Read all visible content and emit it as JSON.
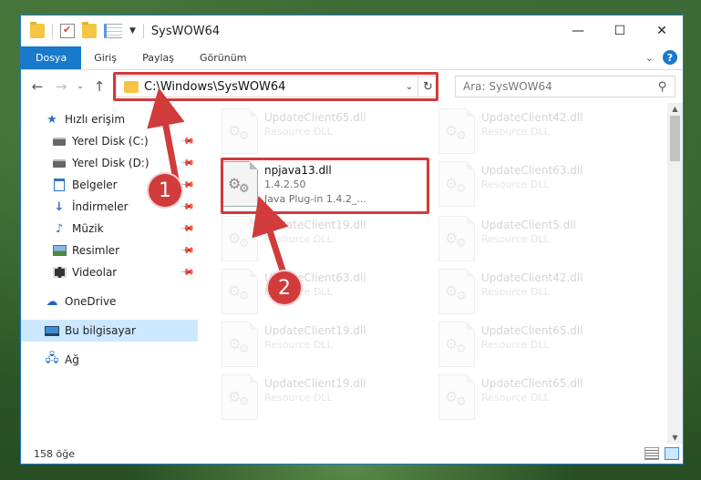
{
  "window": {
    "title": "SysWOW64",
    "controls": {
      "minimize": "—",
      "maximize": "☐",
      "close": "✕"
    }
  },
  "ribbon": {
    "tabs": [
      "Dosya",
      "Giriş",
      "Paylaş",
      "Görünüm"
    ],
    "help": "?"
  },
  "navigation": {
    "address_path": "C:\\Windows\\SysWOW64",
    "search_placeholder": "Ara: SysWOW64"
  },
  "sidebar": {
    "quick_access": "Hızlı erişim",
    "items": [
      {
        "label": "Yerel Disk (C:)",
        "icon": "drive-icon",
        "pinned": true
      },
      {
        "label": "Yerel Disk (D:)",
        "icon": "drive-icon",
        "pinned": true
      },
      {
        "label": "Belgeler",
        "icon": "documents-icon",
        "pinned": true
      },
      {
        "label": "İndirmeler",
        "icon": "downloads-icon",
        "pinned": true
      },
      {
        "label": "Müzik",
        "icon": "music-icon",
        "pinned": true
      },
      {
        "label": "Resimler",
        "icon": "pictures-icon",
        "pinned": true
      },
      {
        "label": "Videolar",
        "icon": "videos-icon",
        "pinned": true
      }
    ],
    "onedrive": "OneDrive",
    "this_pc": "Bu bilgisayar",
    "network": "Ağ"
  },
  "files": {
    "left_column": [
      {
        "name": "UpdateClient65.dll",
        "sub": "Resource DLL",
        "faded": true
      },
      {
        "name": "npjava13.dll",
        "version": "1.4.2.50",
        "sub": "Java Plug-in 1.4.2_...",
        "faded": false
      },
      {
        "name": "UpdateClient19.dll",
        "sub": "Resource DLL",
        "faded": true
      },
      {
        "name": "UpdateClient63.dll",
        "sub": "Resource DLL",
        "faded": true
      },
      {
        "name": "UpdateClient19.dll",
        "sub": "Resource DLL",
        "faded": true
      },
      {
        "name": "UpdateClient19.dll",
        "sub": "Resource DLL",
        "faded": true
      }
    ],
    "right_column": [
      {
        "name": "UpdateClient42.dll",
        "sub": "Resource DLL"
      },
      {
        "name": "UpdateClient63.dll",
        "sub": "Resource DLL"
      },
      {
        "name": "UpdateClient5.dll",
        "sub": "Resource DLL"
      },
      {
        "name": "UpdateClient42.dll",
        "sub": "Resource DLL"
      },
      {
        "name": "UpdateClient65.dll",
        "sub": "Resource DLL"
      },
      {
        "name": "UpdateClient65.dll",
        "sub": "Resource DLL"
      }
    ]
  },
  "status": {
    "item_count": "158 öğe"
  },
  "callouts": [
    "1",
    "2"
  ],
  "colors": {
    "accent": "#1979ca",
    "highlight": "#d23b3b",
    "selected": "#cce8ff"
  }
}
